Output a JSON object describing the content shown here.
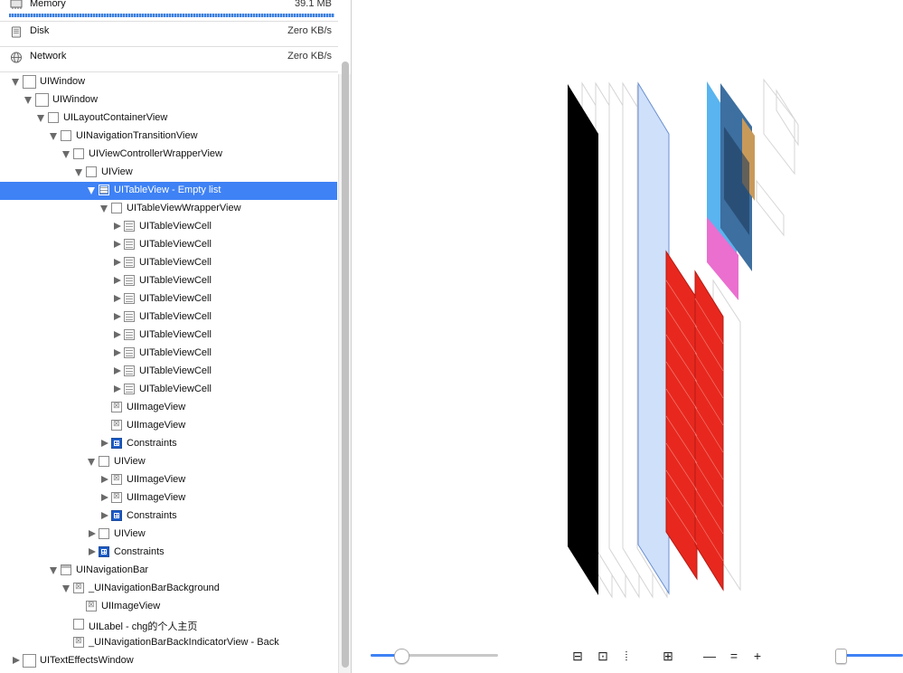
{
  "gauges": {
    "memory": {
      "label": "Memory",
      "value": "39.1 MB",
      "icon": "memory-chip-icon"
    },
    "disk": {
      "label": "Disk",
      "value": "Zero KB/s",
      "icon": "disk-icon"
    },
    "network": {
      "label": "Network",
      "value": "Zero KB/s",
      "icon": "network-globe-icon"
    }
  },
  "tree": [
    {
      "label": "UIWindow",
      "depth": 0,
      "expand": "open",
      "icon": "view",
      "big": true
    },
    {
      "label": "UIWindow",
      "depth": 1,
      "expand": "open",
      "icon": "view",
      "big": true
    },
    {
      "label": "UILayoutContainerView",
      "depth": 2,
      "expand": "open",
      "icon": "view"
    },
    {
      "label": "UINavigationTransitionView",
      "depth": 3,
      "expand": "open",
      "icon": "view"
    },
    {
      "label": "UIViewControllerWrapperView",
      "depth": 4,
      "expand": "open",
      "icon": "view"
    },
    {
      "label": "UIView",
      "depth": 5,
      "expand": "open",
      "icon": "view"
    },
    {
      "label": "UITableView - Empty list",
      "depth": 6,
      "expand": "open",
      "icon": "cell",
      "selected": true
    },
    {
      "label": "UITableViewWrapperView",
      "depth": 7,
      "expand": "open",
      "icon": "view"
    },
    {
      "label": "UITableViewCell",
      "depth": 8,
      "expand": "closed",
      "icon": "cell"
    },
    {
      "label": "UITableViewCell",
      "depth": 8,
      "expand": "closed",
      "icon": "cell"
    },
    {
      "label": "UITableViewCell",
      "depth": 8,
      "expand": "closed",
      "icon": "cell"
    },
    {
      "label": "UITableViewCell",
      "depth": 8,
      "expand": "closed",
      "icon": "cell"
    },
    {
      "label": "UITableViewCell",
      "depth": 8,
      "expand": "closed",
      "icon": "cell"
    },
    {
      "label": "UITableViewCell",
      "depth": 8,
      "expand": "closed",
      "icon": "cell"
    },
    {
      "label": "UITableViewCell",
      "depth": 8,
      "expand": "closed",
      "icon": "cell"
    },
    {
      "label": "UITableViewCell",
      "depth": 8,
      "expand": "closed",
      "icon": "cell"
    },
    {
      "label": "UITableViewCell",
      "depth": 8,
      "expand": "closed",
      "icon": "cell"
    },
    {
      "label": "UITableViewCell",
      "depth": 8,
      "expand": "closed",
      "icon": "cell"
    },
    {
      "label": "UIImageView",
      "depth": 7,
      "expand": "none",
      "icon": "image"
    },
    {
      "label": "UIImageView",
      "depth": 7,
      "expand": "none",
      "icon": "image"
    },
    {
      "label": "Constraints",
      "depth": 7,
      "expand": "closed",
      "icon": "cons"
    },
    {
      "label": "UIView",
      "depth": 6,
      "expand": "open",
      "icon": "view"
    },
    {
      "label": "UIImageView",
      "depth": 7,
      "expand": "closed",
      "icon": "image"
    },
    {
      "label": "UIImageView",
      "depth": 7,
      "expand": "closed",
      "icon": "image"
    },
    {
      "label": "Constraints",
      "depth": 7,
      "expand": "closed",
      "icon": "cons"
    },
    {
      "label": "UIView",
      "depth": 6,
      "expand": "closed",
      "icon": "view"
    },
    {
      "label": "Constraints",
      "depth": 6,
      "expand": "closed",
      "icon": "cons"
    },
    {
      "label": "UINavigationBar",
      "depth": 3,
      "expand": "open",
      "icon": "navbar"
    },
    {
      "label": "_UINavigationBarBackground",
      "depth": 4,
      "expand": "open",
      "icon": "image"
    },
    {
      "label": "UIImageView",
      "depth": 5,
      "expand": "none",
      "icon": "image"
    },
    {
      "label": "UILabel - chg的个人主页",
      "depth": 4,
      "expand": "none",
      "icon": "view"
    },
    {
      "label": "_UINavigationBarBackIndicatorView - Back",
      "depth": 4,
      "expand": "none",
      "icon": "image"
    },
    {
      "label": "UITextEffectsWindow",
      "depth": 0,
      "expand": "closed",
      "icon": "view",
      "big": true
    }
  ],
  "colors": {
    "selection": "#3f82f5",
    "accent": "#3f82f5",
    "layer_black": "#000000",
    "layer_blue_light": "#cfe0fb",
    "layer_red": "#e8281e",
    "layer_sky": "#59b4ef",
    "layer_pink": "#ea6fcf"
  },
  "controls": {
    "spacing_slider": {
      "value": 0.24,
      "icon": "layer-spacing-slider"
    },
    "zoom_slider": {
      "value": 0.05,
      "icon": "zoom-slider"
    },
    "tools": [
      {
        "name": "show-clipped-content-icon",
        "glyph": "⊟"
      },
      {
        "name": "show-constraints-icon",
        "glyph": "⊡"
      },
      {
        "name": "show-wireframes-icon",
        "glyph": "⦙"
      },
      {
        "name": "grid-view-icon",
        "glyph": "⊞"
      },
      {
        "name": "zoom-out-icon",
        "glyph": "—"
      },
      {
        "name": "actual-size-icon",
        "glyph": "="
      },
      {
        "name": "zoom-in-icon",
        "glyph": "+"
      }
    ]
  }
}
